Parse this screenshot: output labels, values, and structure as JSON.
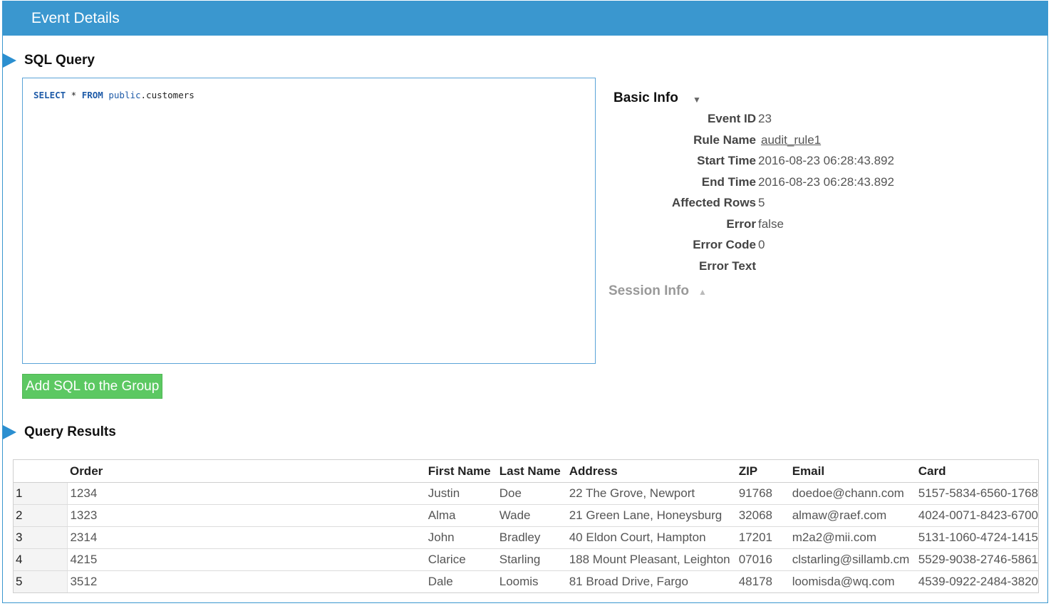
{
  "header": {
    "title": "Event Details"
  },
  "sql_section": {
    "title": "SQL Query",
    "query_tokens": {
      "select": "SELECT",
      "star": " * ",
      "from": "FROM",
      "schema": "public",
      "table": ".customers"
    },
    "add_button_label": "Add SQL to the Group"
  },
  "basic_info": {
    "title": "Basic Info",
    "rows": [
      {
        "label": "Event ID",
        "value": "23"
      },
      {
        "label": "Rule Name",
        "value": "audit_rule1"
      },
      {
        "label": "Start Time",
        "value": "2016-08-23 06:28:43.892"
      },
      {
        "label": "End Time",
        "value": "2016-08-23 06:28:43.892"
      },
      {
        "label": "Affected Rows",
        "value": "5"
      },
      {
        "label": "Error",
        "value": "false"
      },
      {
        "label": "Error Code",
        "value": "0"
      },
      {
        "label": "Error Text",
        "value": ""
      }
    ]
  },
  "session_info": {
    "title": "Session Info"
  },
  "results": {
    "title": "Query Results",
    "columns": [
      "",
      "Order",
      "First Name",
      "Last Name",
      "Address",
      "ZIP",
      "Email",
      "Card"
    ],
    "rows": [
      [
        "1",
        "1234",
        "Justin",
        "Doe",
        "22 The Grove, Newport",
        "91768",
        "doedoe@chann.com",
        "5157-5834-6560-1768"
      ],
      [
        "2",
        "1323",
        "Alma",
        "Wade",
        "21 Green Lane, Honeysburg",
        "32068",
        "almaw@raef.com",
        "4024-0071-8423-6700"
      ],
      [
        "3",
        "2314",
        "John",
        "Bradley",
        "40 Eldon Court, Hampton",
        "17201",
        "m2a2@mii.com",
        "5131-1060-4724-1415"
      ],
      [
        "4",
        "4215",
        "Clarice",
        "Starling",
        "188 Mount Pleasant, Leighton",
        "07016",
        "clstarling@sillamb.cm",
        "5529-9038-2746-5861"
      ],
      [
        "5",
        "3512",
        "Dale",
        "Loomis",
        "81 Broad Drive, Fargo",
        "48178",
        "loomisda@wq.com",
        "4539-0922-2484-3820"
      ]
    ]
  },
  "colors": {
    "header": "#3a97cf",
    "button": "#5cc862",
    "section_arrow": "#2b8fd0"
  }
}
